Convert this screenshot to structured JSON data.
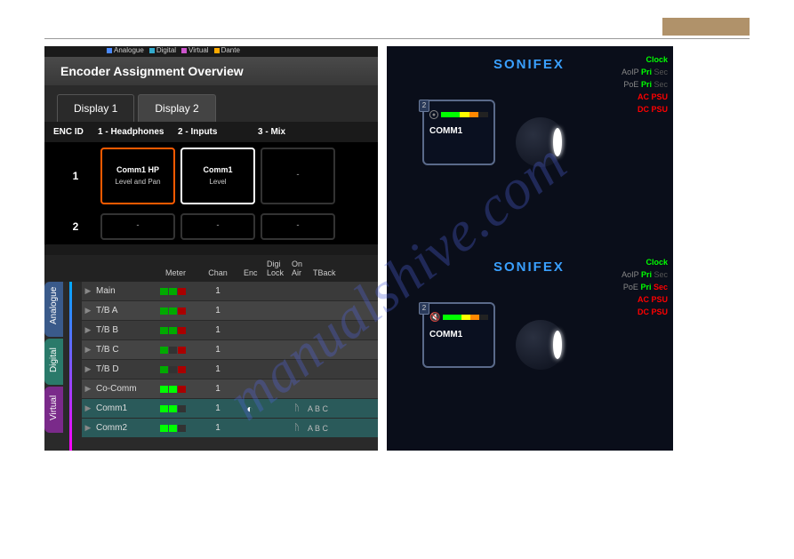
{
  "watermark": "manualshive.com",
  "left": {
    "legend": [
      "Analogue",
      "Digital",
      "Virtual",
      "Dante"
    ],
    "title": "Encoder Assignment Overview",
    "tabs": [
      "Display 1",
      "Display 2"
    ],
    "active_tab": 0,
    "columns": [
      "ENC ID",
      "1 - Headphones",
      "2 - Inputs",
      "3 - Mix"
    ],
    "rows": [
      {
        "id": "1",
        "cells": [
          {
            "l1": "Comm1 HP",
            "l2": "Level and Pan",
            "style": "highlight-orange"
          },
          {
            "l1": "Comm1",
            "l2": "Level",
            "style": "highlight-white"
          },
          {
            "l1": "-",
            "l2": "",
            "style": "empty"
          }
        ]
      },
      {
        "id": "2",
        "cells": [
          {
            "l1": "-",
            "l2": "",
            "style": "empty"
          },
          {
            "l1": "-",
            "l2": "",
            "style": "empty"
          },
          {
            "l1": "-",
            "l2": "",
            "style": "empty"
          }
        ]
      }
    ],
    "chan_headers": [
      "Meter",
      "Chan",
      "Enc",
      "Digi Lock",
      "On Air",
      "TBack"
    ],
    "side_tabs": [
      "Analogue",
      "Digital",
      "Virtual"
    ],
    "channels": [
      {
        "name": "Main",
        "meter": [
          "g",
          "g",
          "r"
        ],
        "chan": "1",
        "enc": "",
        "onair": "",
        "tback": ""
      },
      {
        "name": "T/B A",
        "meter": [
          "g",
          "g",
          "r"
        ],
        "chan": "1",
        "enc": "",
        "onair": "",
        "tback": ""
      },
      {
        "name": "T/B B",
        "meter": [
          "g",
          "g",
          "r"
        ],
        "chan": "1",
        "enc": "",
        "onair": "",
        "tback": ""
      },
      {
        "name": "T/B C",
        "meter": [
          "g",
          "off",
          "r"
        ],
        "chan": "1",
        "enc": "",
        "onair": "",
        "tback": ""
      },
      {
        "name": "T/B D",
        "meter": [
          "g",
          "off",
          "r"
        ],
        "chan": "1",
        "enc": "",
        "onair": "",
        "tback": ""
      },
      {
        "name": "Co-Comm",
        "meter": [
          "gb",
          "gb",
          "r"
        ],
        "chan": "1",
        "enc": "",
        "onair": "",
        "tback": ""
      },
      {
        "name": "Comm1",
        "meter": [
          "gb",
          "gb",
          "off"
        ],
        "chan": "1",
        "enc": "◐",
        "onair": "ᚤ",
        "tback": "A B C"
      },
      {
        "name": "Comm2",
        "meter": [
          "gb",
          "gb",
          "off"
        ],
        "chan": "1",
        "enc": "",
        "onair": "ᚤ",
        "tback": "A B C"
      }
    ]
  },
  "right": {
    "brand": "SONIFEX",
    "panels": [
      {
        "badge": "2",
        "icon": "dot",
        "label": "COMM1",
        "sec": "off"
      },
      {
        "badge": "2",
        "icon": "mute",
        "label": "COMM1",
        "sec": "on"
      }
    ],
    "status": {
      "clock": "Clock",
      "aoip": "AoIP",
      "poe": "PoE",
      "pri": "Pri",
      "sec": "Sec",
      "acpsu": "AC PSU",
      "dcpsu": "DC PSU"
    }
  }
}
